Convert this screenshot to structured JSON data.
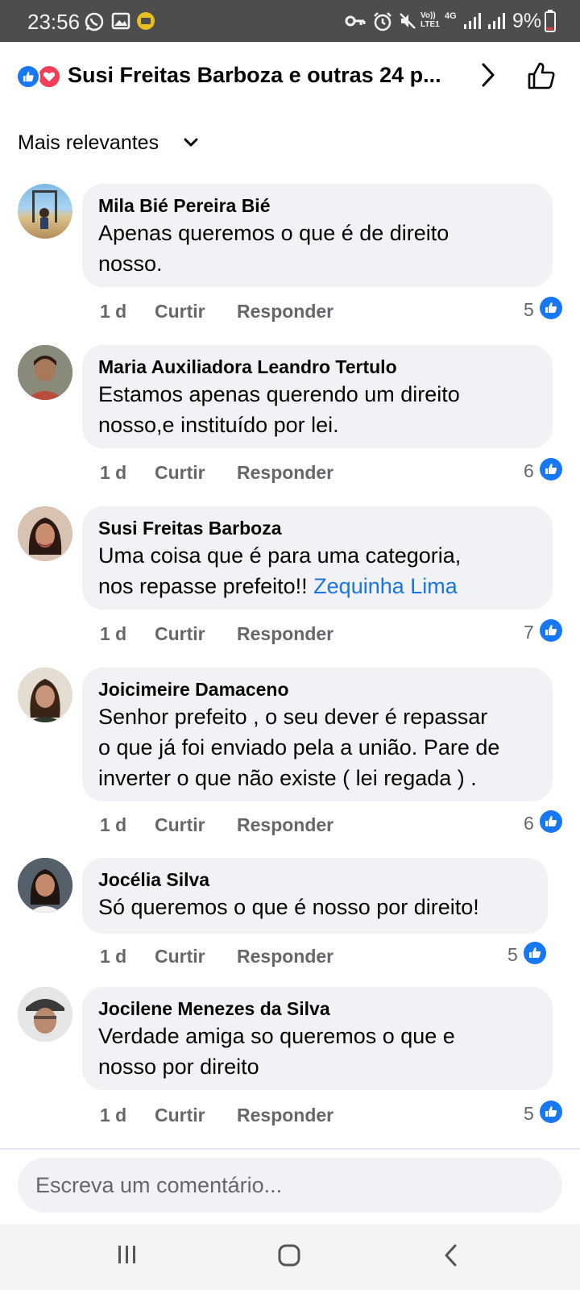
{
  "status_bar": {
    "time": "23:56",
    "network": "Vo)) LTE1",
    "network_type": "4G",
    "battery": "9%"
  },
  "header": {
    "title": "Susi Freitas Barboza e outras 24 p...",
    "reactions": [
      "like",
      "love"
    ]
  },
  "sort": {
    "label": "Mais relevantes"
  },
  "comments": [
    {
      "author": "Mila Bié Pereira Bié",
      "text": "Apenas queremos o que é de direito\nnosso.",
      "time": "1 d",
      "like_action": "Curtir",
      "reply_action": "Responder",
      "likes": "5"
    },
    {
      "author": "Maria Auxiliadora Leandro Tertulo",
      "text": "Estamos apenas querendo um direito\nnosso,e instituído por lei.",
      "time": "1 d",
      "like_action": "Curtir",
      "reply_action": "Responder",
      "likes": "6"
    },
    {
      "author": "Susi Freitas Barboza",
      "text": "Uma coisa que é  para uma categoria,\nnos repasse  prefeito!!",
      "mention": "Zequinha Lima",
      "time": "1 d",
      "like_action": "Curtir",
      "reply_action": "Responder",
      "likes": "7"
    },
    {
      "author": "Joicimeire Damaceno",
      "text": "Senhor prefeito , o seu dever é repassar\no que já foi enviado pela a união. Pare de\ninverter o que não existe ( lei regada ) .",
      "time": "1 d",
      "like_action": "Curtir",
      "reply_action": "Responder",
      "likes": "6"
    },
    {
      "author": "Jocélia Silva",
      "text": "Só queremos o que é nosso por direito!",
      "time": "1 d",
      "like_action": "Curtir",
      "reply_action": "Responder",
      "likes": "5"
    },
    {
      "author": "Jocilene Menezes da Silva",
      "text": "Verdade amiga so queremos o que e\nnosso por direito",
      "time": "1 d",
      "like_action": "Curtir",
      "reply_action": "Responder",
      "likes": "5"
    }
  ],
  "composer": {
    "placeholder": "Escreva um comentário..."
  },
  "icons": {
    "header": [
      "like-icon",
      "love-icon",
      "chevron-right-icon",
      "thumbs-up-outline-icon"
    ],
    "nav": [
      "recent-apps-icon",
      "home-icon",
      "back-icon"
    ]
  },
  "colors": {
    "accent": "#1877f2",
    "love": "#f33e58",
    "bubble": "#f0f2f5",
    "meta": "#65676b",
    "status_bar": "#4d4d4d"
  }
}
